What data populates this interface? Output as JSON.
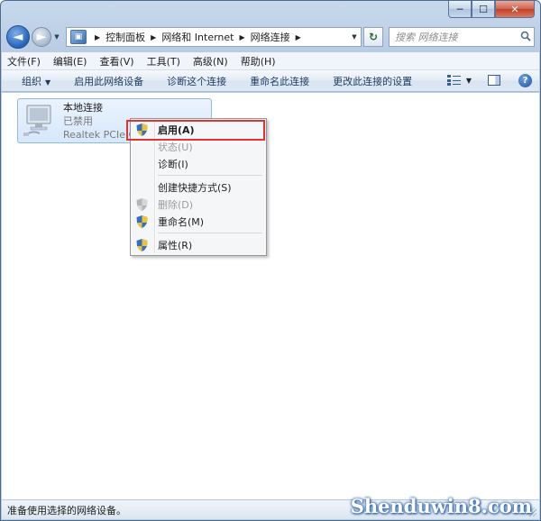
{
  "window": {
    "caption_buttons": {
      "minimize": "─",
      "maximize": "☐",
      "close": "✕"
    }
  },
  "nav": {
    "back": "◄",
    "forward": "►",
    "history": "▼"
  },
  "address": {
    "crumbs": [
      "控制面板",
      "网络和 Internet",
      "网络连接"
    ],
    "separator": "▶",
    "dropdown": "▼",
    "refresh": "↻"
  },
  "search": {
    "placeholder": "搜索 网络连接",
    "icon": "search-icon"
  },
  "menubar": {
    "items": [
      "文件(F)",
      "编辑(E)",
      "查看(V)",
      "工具(T)",
      "高级(N)",
      "帮助(H)"
    ]
  },
  "commandbar": {
    "organize": "组织",
    "organize_caret": "▼",
    "items": [
      "启用此网络设备",
      "诊断这个连接",
      "重命名此连接",
      "更改此连接的设置"
    ],
    "view_caret": "▼",
    "help": "?"
  },
  "connection": {
    "name": "本地连接",
    "status": "已禁用",
    "device": "Realtek PCIe G"
  },
  "context_menu": {
    "items": [
      {
        "label": "启用(A)",
        "shield": true,
        "disabled": false,
        "bold": true
      },
      {
        "label": "状态(U)",
        "shield": false,
        "disabled": true,
        "bold": false
      },
      {
        "label": "诊断(I)",
        "shield": false,
        "disabled": false,
        "bold": false
      },
      {
        "label": "创建快捷方式(S)",
        "shield": false,
        "disabled": false,
        "bold": false
      },
      {
        "label": "删除(D)",
        "shield": true,
        "disabled": true,
        "bold": false
      },
      {
        "label": "重命名(M)",
        "shield": true,
        "disabled": false,
        "bold": false
      },
      {
        "label": "属性(R)",
        "shield": true,
        "disabled": false,
        "bold": false
      }
    ]
  },
  "statusbar": {
    "text": "准备使用选择的网络设备。"
  },
  "watermark": "Shenduwin8.com",
  "colors": {
    "highlight_border": "#e23232",
    "accent": "#2463b8"
  }
}
